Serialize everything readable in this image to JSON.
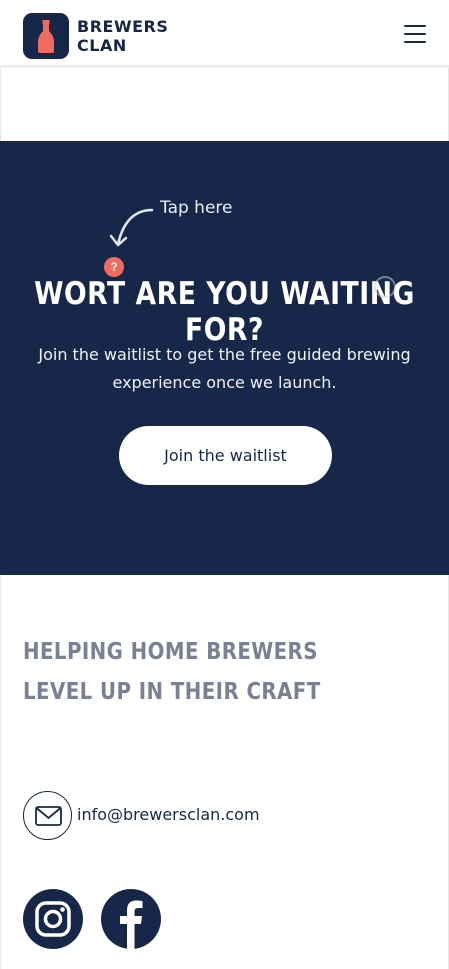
{
  "brand": {
    "line1": "BREWERS",
    "line2": "CLAN"
  },
  "header": {
    "menu_icon": "hamburger-menu-icon"
  },
  "hero": {
    "hint_label": "Tap here",
    "hint_badge": "?",
    "title": "WORT ARE YOU WAITING FOR?",
    "description": "Join the waitlist to get the free guided brewing experience once we launch.",
    "cta_label": "Join the waitlist"
  },
  "tagline": "HELPING HOME BREWERS LEVEL UP IN THEIR CRAFT",
  "contact": {
    "email": "info@brewersclan.com",
    "icon": "mail-icon"
  },
  "social": {
    "icons": [
      "instagram-icon",
      "facebook-icon"
    ]
  },
  "colors": {
    "navy": "#17274a",
    "accent": "#ee6b5e",
    "tagline_gray": "#7a8196"
  }
}
